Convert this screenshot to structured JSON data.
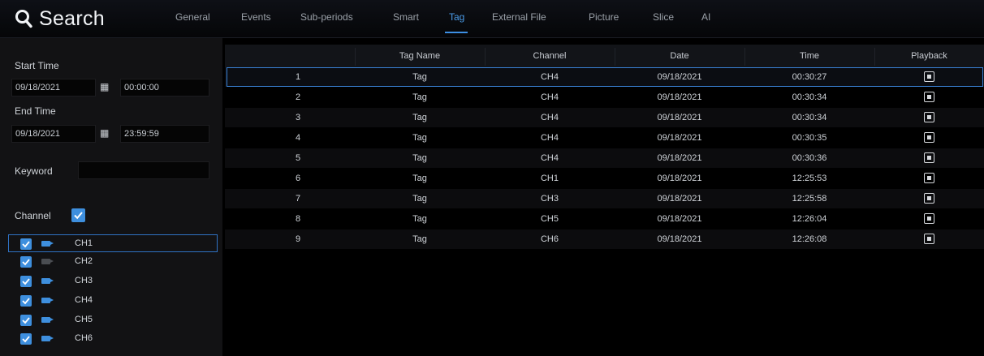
{
  "header": {
    "title": "Search",
    "icon": "search-icon"
  },
  "tabs": [
    {
      "label": "General"
    },
    {
      "label": "Events"
    },
    {
      "label": "Sub-periods"
    },
    {
      "label": "Smart"
    },
    {
      "label": "Tag",
      "active": true
    },
    {
      "label": "External File"
    },
    {
      "label": "Picture"
    },
    {
      "label": "Slice"
    },
    {
      "label": "AI"
    }
  ],
  "sidebar": {
    "start_time_label": "Start Time",
    "start_date": "09/18/2021",
    "start_time": "00:00:00",
    "end_time_label": "End Time",
    "end_date": "09/18/2021",
    "end_time": "23:59:59",
    "keyword_label": "Keyword",
    "keyword_value": "",
    "channel_label": "Channel",
    "channel_all_checked": true,
    "channels": [
      {
        "name": "CH1",
        "checked": true,
        "camera_active": true,
        "selected": true
      },
      {
        "name": "CH2",
        "checked": true,
        "camera_active": false
      },
      {
        "name": "CH3",
        "checked": true,
        "camera_active": true
      },
      {
        "name": "CH4",
        "checked": true,
        "camera_active": true
      },
      {
        "name": "CH5",
        "checked": true,
        "camera_active": true
      },
      {
        "name": "CH6",
        "checked": true,
        "camera_active": true
      }
    ]
  },
  "table": {
    "headers": [
      "",
      "Tag Name",
      "Channel",
      "Date",
      "Time",
      "Playback"
    ],
    "rows": [
      {
        "no": "1",
        "tag": "Tag",
        "channel": "CH4",
        "date": "09/18/2021",
        "time": "00:30:27"
      },
      {
        "no": "2",
        "tag": "Tag",
        "channel": "CH4",
        "date": "09/18/2021",
        "time": "00:30:34"
      },
      {
        "no": "3",
        "tag": "Tag",
        "channel": "CH4",
        "date": "09/18/2021",
        "time": "00:30:34"
      },
      {
        "no": "4",
        "tag": "Tag",
        "channel": "CH4",
        "date": "09/18/2021",
        "time": "00:30:35"
      },
      {
        "no": "5",
        "tag": "Tag",
        "channel": "CH4",
        "date": "09/18/2021",
        "time": "00:30:36"
      },
      {
        "no": "6",
        "tag": "Tag",
        "channel": "CH1",
        "date": "09/18/2021",
        "time": "12:25:53"
      },
      {
        "no": "7",
        "tag": "Tag",
        "channel": "CH3",
        "date": "09/18/2021",
        "time": "12:25:58"
      },
      {
        "no": "8",
        "tag": "Tag",
        "channel": "CH5",
        "date": "09/18/2021",
        "time": "12:26:04"
      },
      {
        "no": "9",
        "tag": "Tag",
        "channel": "CH6",
        "date": "09/18/2021",
        "time": "12:26:08"
      }
    ],
    "playback_icon": "play-box-icon"
  },
  "colors": {
    "accent": "#3d8fe4",
    "checkbox": "#3e8fde",
    "background": "#000000",
    "sidebar": "#121214"
  }
}
